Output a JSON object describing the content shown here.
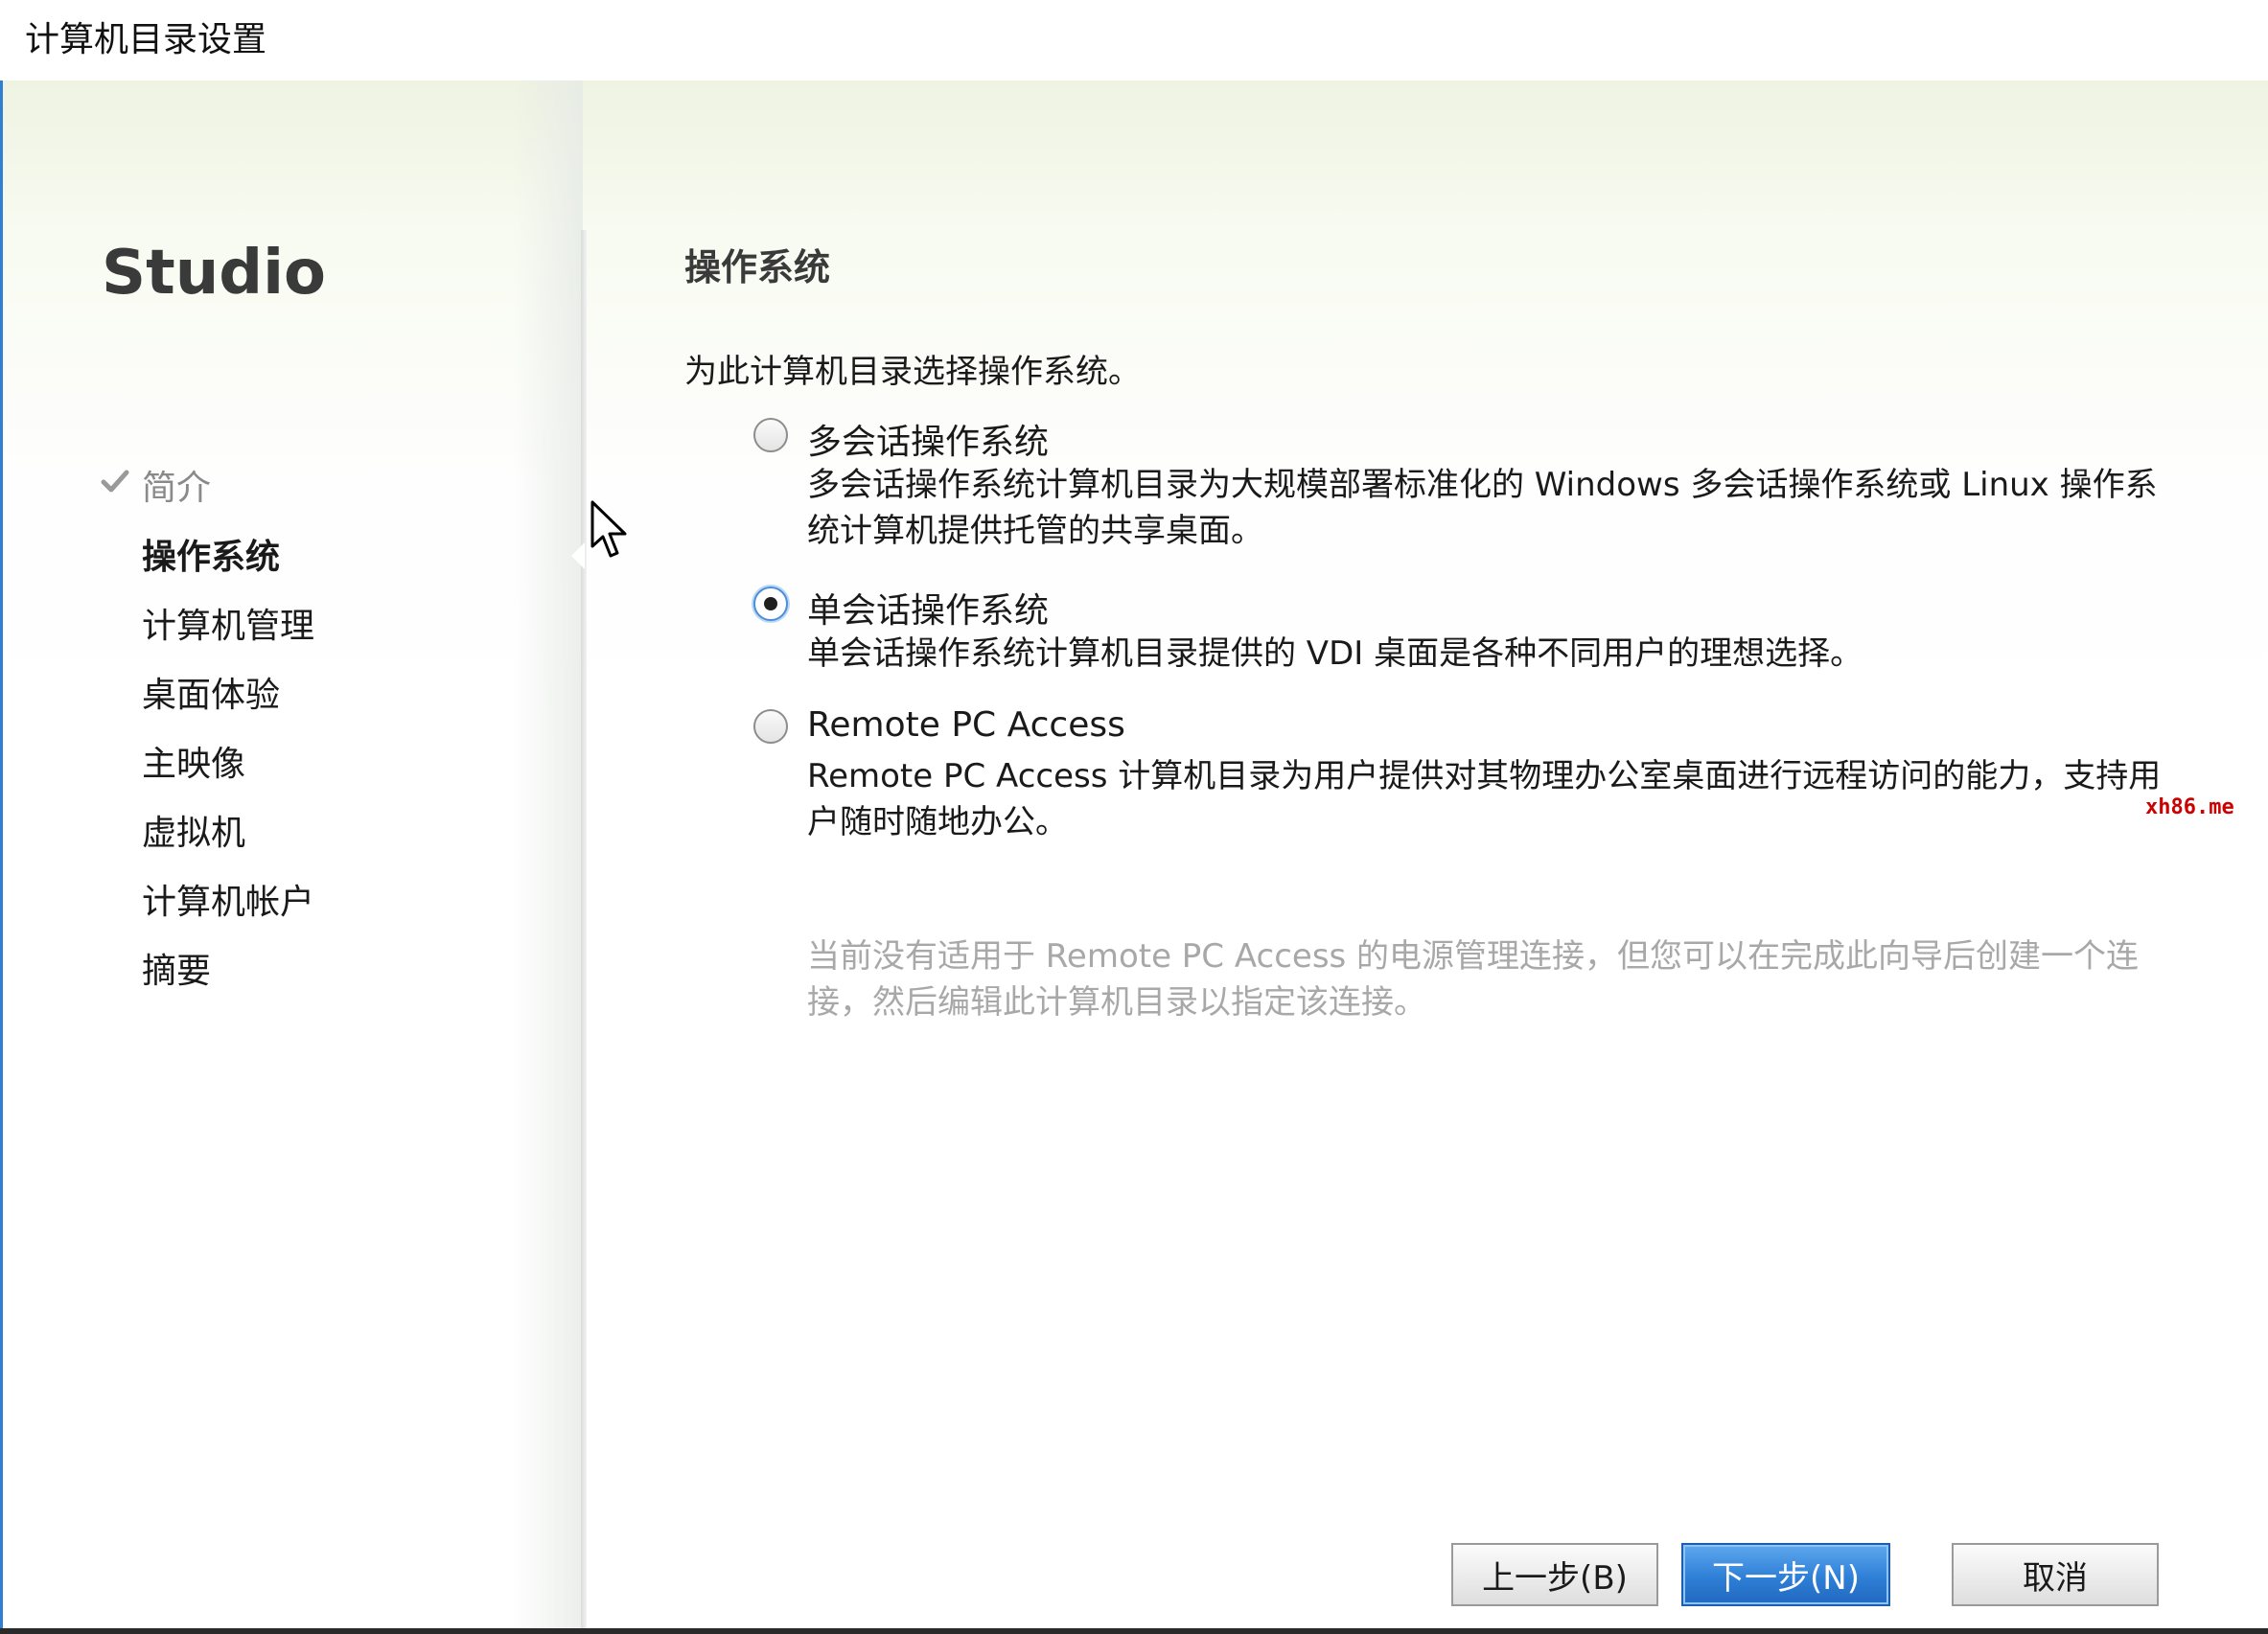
{
  "window": {
    "title": "计算机目录设置"
  },
  "sidebar": {
    "brand": "Studio",
    "steps": [
      {
        "label": "简介",
        "state": "done"
      },
      {
        "label": "操作系统",
        "state": "active"
      },
      {
        "label": "计算机管理",
        "state": "pending"
      },
      {
        "label": "桌面体验",
        "state": "pending"
      },
      {
        "label": "主映像",
        "state": "pending"
      },
      {
        "label": "虚拟机",
        "state": "pending"
      },
      {
        "label": "计算机帐户",
        "state": "pending"
      },
      {
        "label": "摘要",
        "state": "pending"
      }
    ]
  },
  "main": {
    "title": "操作系统",
    "instruction": "为此计算机目录选择操作系统。",
    "options": [
      {
        "label": "多会话操作系统",
        "description": "多会话操作系统计算机目录为大规模部署标准化的 Windows 多会话操作系统或 Linux 操作系统计算机提供托管的共享桌面。",
        "selected": false
      },
      {
        "label": "单会话操作系统",
        "description": "单会话操作系统计算机目录提供的 VDI 桌面是各种不同用户的理想选择。",
        "selected": true
      },
      {
        "label": "Remote PC Access",
        "description": "Remote PC Access 计算机目录为用户提供对其物理办公室桌面进行远程访问的能力，支持用户随时随地办公。",
        "selected": false
      }
    ],
    "note": "当前没有适用于 Remote PC Access 的电源管理连接，但您可以在完成此向导后创建一个连接，然后编辑此计算机目录以指定该连接。"
  },
  "watermark": "xh86.me",
  "buttons": {
    "back": "上一步(B)",
    "next": "下一步(N)",
    "cancel": "取消"
  },
  "colors": {
    "accent": "#2e7fd6",
    "window_edge": "#2f7fd3",
    "disabled_text": "#a8a8a8"
  }
}
